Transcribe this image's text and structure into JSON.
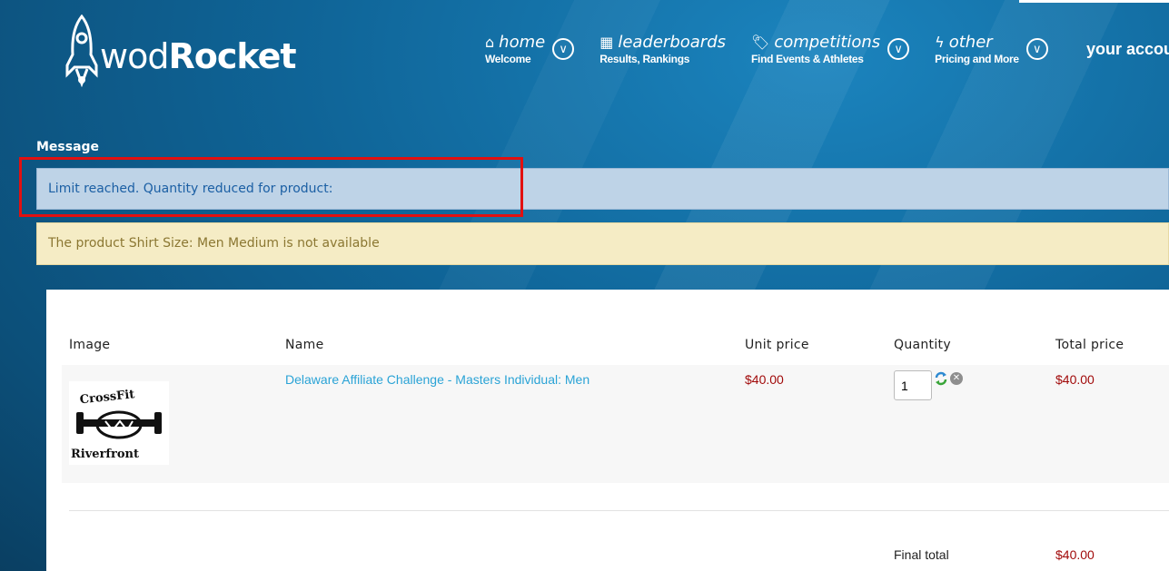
{
  "brand": {
    "prefix": "wod",
    "name": "Rocket"
  },
  "nav": [
    {
      "icon": "home-icon",
      "title": "home",
      "sub": "Welcome"
    },
    {
      "icon": "grid-icon",
      "title": "leaderboards",
      "sub": "Results, Rankings"
    },
    {
      "icon": "tag-icon",
      "title": "competitions",
      "sub": "Find Events & Athletes"
    },
    {
      "icon": "bolt-icon",
      "title": "other",
      "sub": "Pricing and More"
    }
  ],
  "account_label": "your account",
  "messages": {
    "heading": "Message",
    "info": "Limit reached. Quantity reduced for product:",
    "warning": "The product Shirt Size: Men Medium is not available"
  },
  "cart": {
    "headers": {
      "image": "Image",
      "name": "Name",
      "unit_price": "Unit price",
      "quantity": "Quantity",
      "total_price": "Total price"
    },
    "items": [
      {
        "image_alt": "CrossFit Riverfront logo",
        "logo_top": "CrossFit",
        "logo_bottom": "Riverfront",
        "name": "Delaware Affiliate Challenge - Masters Individual: Men",
        "unit_price": "$40.00",
        "quantity": "1",
        "total_price": "$40.00"
      }
    ],
    "final_total_label": "Final total",
    "final_total_value": "$40.00"
  },
  "colors": {
    "info_bg": "#bed3e7",
    "warning_bg": "#f5ecc5",
    "price": "#a10a0a",
    "link": "#2aa3d6",
    "highlight": "#e21010"
  }
}
